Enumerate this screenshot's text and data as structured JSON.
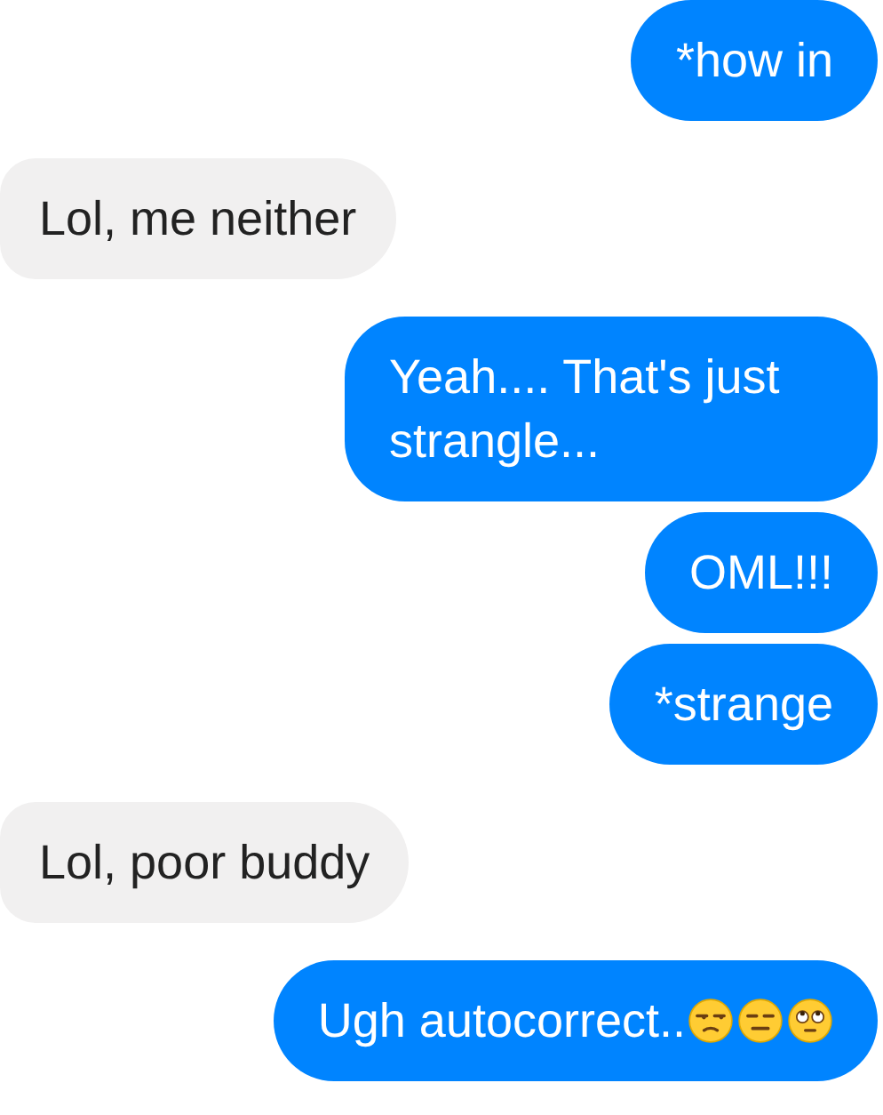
{
  "messages": [
    {
      "kind": "sent",
      "text": "*how in"
    },
    {
      "kind": "received",
      "text": "Lol, me neither"
    },
    {
      "kind": "sent",
      "text": "Yeah.... That's just strangle..."
    },
    {
      "kind": "sent",
      "text": "OML!!!"
    },
    {
      "kind": "sent",
      "text": "*strange"
    },
    {
      "kind": "received",
      "text": "Lol, poor buddy"
    },
    {
      "kind": "sent",
      "text": "Ugh autocorrect..",
      "emoji": [
        {
          "kind": "unamused"
        },
        {
          "kind": "expressionless"
        },
        {
          "kind": "eye_roll"
        }
      ]
    }
  ]
}
